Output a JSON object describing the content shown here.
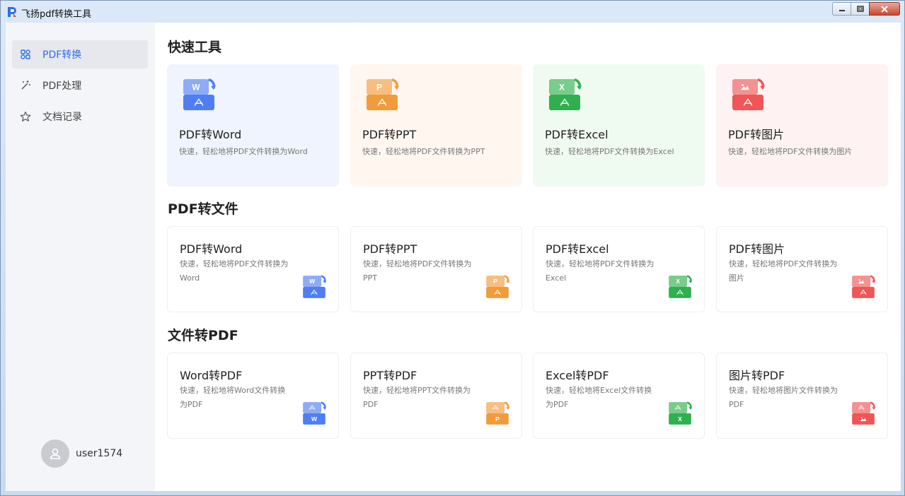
{
  "window": {
    "title": "飞扬pdf转换工具"
  },
  "sidebar": {
    "items": [
      {
        "label": "PDF转换",
        "icon": "grid-convert-icon",
        "active": true
      },
      {
        "label": "PDF处理",
        "icon": "magic-wand-icon",
        "active": false
      },
      {
        "label": "文档记录",
        "icon": "star-icon",
        "active": false
      }
    ],
    "user": {
      "name": "user1574",
      "icon": "user-avatar-icon"
    }
  },
  "sections": [
    {
      "title": "快速工具",
      "cards": [
        {
          "title": "PDF转Word",
          "desc": "快速，轻松地将PDF文件转换为Word",
          "icon": "pdf-to-word-icon",
          "color": "#4f7df3",
          "letter": "W"
        },
        {
          "title": "PDF转PPT",
          "desc": "快速，轻松地将PDF文件转换为PPT",
          "icon": "pdf-to-ppt-icon",
          "color": "#f29b3a",
          "letter": "P"
        },
        {
          "title": "PDF转Excel",
          "desc": "快速，轻松地将PDF文件转换为Excel",
          "icon": "pdf-to-excel-icon",
          "color": "#2fb04e",
          "letter": "X"
        },
        {
          "title": "PDF转图片",
          "desc": "快速，轻松地将PDF文件转换为图片",
          "icon": "pdf-to-image-icon",
          "color": "#ef5655",
          "letter": ""
        }
      ]
    },
    {
      "title": "PDF转文件",
      "cards": [
        {
          "title": "PDF转Word",
          "desc": "快速，轻松地将PDF文件转换为Word",
          "icon": "pdf-to-word-icon",
          "color": "#4f7df3",
          "letter": "W"
        },
        {
          "title": "PDF转PPT",
          "desc": "快速，轻松地将PDF文件转换为PPT",
          "icon": "pdf-to-ppt-icon",
          "color": "#f29b3a",
          "letter": "P"
        },
        {
          "title": "PDF转Excel",
          "desc": "快速，轻松地将PDF文件转换为Excel",
          "icon": "pdf-to-excel-icon",
          "color": "#2fb04e",
          "letter": "X"
        },
        {
          "title": "PDF转图片",
          "desc": "快速，轻松地将PDF文件转换为图片",
          "icon": "pdf-to-image-icon",
          "color": "#ef5655",
          "letter": ""
        }
      ]
    },
    {
      "title": "文件转PDF",
      "cards": [
        {
          "title": "Word转PDF",
          "desc": "快速，轻松地将Word文件转换为PDF",
          "icon": "word-to-pdf-icon",
          "color": "#4f7df3",
          "letter": "W"
        },
        {
          "title": "PPT转PDF",
          "desc": "快速，轻松地将PPT文件转换为PDF",
          "icon": "ppt-to-pdf-icon",
          "color": "#f29b3a",
          "letter": "P"
        },
        {
          "title": "Excel转PDF",
          "desc": "快速，轻松地将Excel文件转换为PDF",
          "icon": "excel-to-pdf-icon",
          "color": "#2fb04e",
          "letter": "X"
        },
        {
          "title": "图片转PDF",
          "desc": "快速，轻松地将图片文件转换为PDF",
          "icon": "image-to-pdf-icon",
          "color": "#ef5655",
          "letter": ""
        }
      ]
    }
  ],
  "card_backgrounds": [
    "#eff4fe",
    "#fff6f0",
    "#effbf1",
    "#fef3f2"
  ]
}
